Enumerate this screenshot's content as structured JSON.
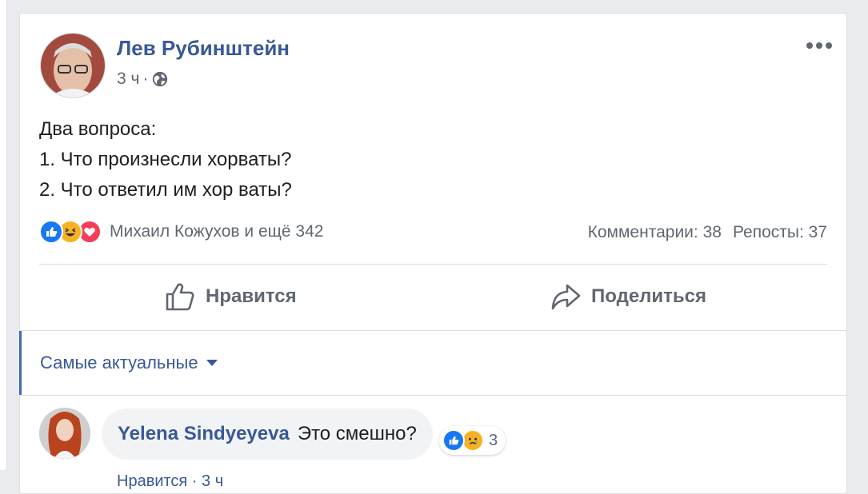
{
  "post": {
    "author": "Лев Рубинштейн",
    "time": "3 ч",
    "separator": "·",
    "text_lines": [
      "Два вопроса:",
      "1. Что произнесли хорваты?",
      "2. Что ответил им хор ваты?"
    ],
    "reactions_names": "Михаил Кожухов и ещё 342",
    "comments_count": "Комментарии: 38",
    "shares_count": "Репосты: 37",
    "like_label": "Нравится",
    "share_label": "Поделиться"
  },
  "comments_section": {
    "sort_label": "Самые актуальные",
    "comment": {
      "author": "Yelena Sindyeyeva",
      "text": "Это смешно?",
      "reaction_count": "3",
      "footer": "Нравится · 3 ч"
    }
  },
  "colors": {
    "accent": "#385898",
    "like_blue": "#1877f2",
    "haha_yellow": "#f7b125",
    "love_red": "#f33e58"
  }
}
